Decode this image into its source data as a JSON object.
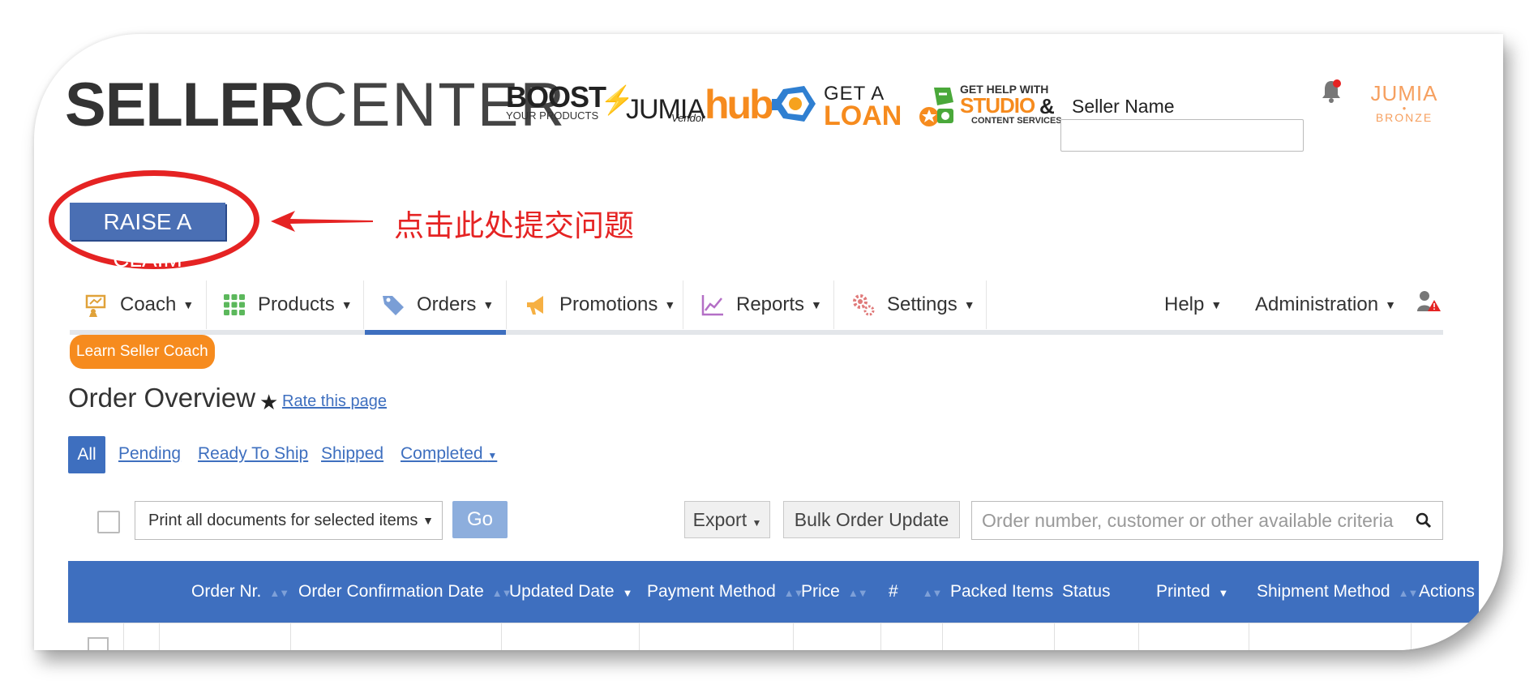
{
  "header": {
    "logo_bold": "SELLER",
    "logo_light": "CENTER",
    "banners": {
      "boost_title": "BOOST",
      "boost_sub": "YOUR PRODUCTS",
      "hub_jumia": "JUMIA",
      "hub_hub": "hub",
      "hub_vendor": "Vendor",
      "loan_get": "GET A",
      "loan_loan": "LOAN",
      "studio_line1": "GET HELP WITH",
      "studio_line2": "STUDIO",
      "studio_amp": "&",
      "studio_line3": "CONTENT SERVICES"
    },
    "seller_name_label": "Seller Name",
    "seller_name_value": "",
    "tier_brand": "JUMIA",
    "tier_level": "BRONZE"
  },
  "claim": {
    "button_label": "RAISE A CLAIM",
    "callout_text": "点击此处提交问题"
  },
  "nav": {
    "items": [
      {
        "label": "Coach",
        "icon": "coach-icon"
      },
      {
        "label": "Products",
        "icon": "grid-icon"
      },
      {
        "label": "Orders",
        "icon": "tag-icon"
      },
      {
        "label": "Promotions",
        "icon": "megaphone-icon"
      },
      {
        "label": "Reports",
        "icon": "chart-icon"
      },
      {
        "label": "Settings",
        "icon": "gear-icon"
      }
    ],
    "right": [
      {
        "label": "Help"
      },
      {
        "label": "Administration"
      }
    ],
    "active": "Orders",
    "learn_coach": "Learn Seller Coach"
  },
  "page": {
    "title": "Order Overview",
    "rate_link": "Rate this page"
  },
  "tabs": {
    "all": "All",
    "pending": "Pending",
    "ready_to_ship": "Ready To Ship",
    "shipped": "Shipped",
    "completed": "Completed"
  },
  "toolbar": {
    "doc_select_value": "Print all documents for selected items",
    "go": "Go",
    "export": "Export",
    "bulk_update": "Bulk Order Update",
    "search_placeholder": "Order number, customer or other available criteria"
  },
  "table": {
    "columns": [
      "Order Nr.",
      "Order Confirmation Date",
      "Updated Date",
      "Payment Method",
      "Price",
      "#",
      "Packed Items",
      "Status",
      "Printed",
      "Shipment Method",
      "Actions"
    ]
  },
  "colors": {
    "primary_blue": "#3e6fbf",
    "orange": "#f68b1e",
    "annotation_red": "#e52323"
  }
}
